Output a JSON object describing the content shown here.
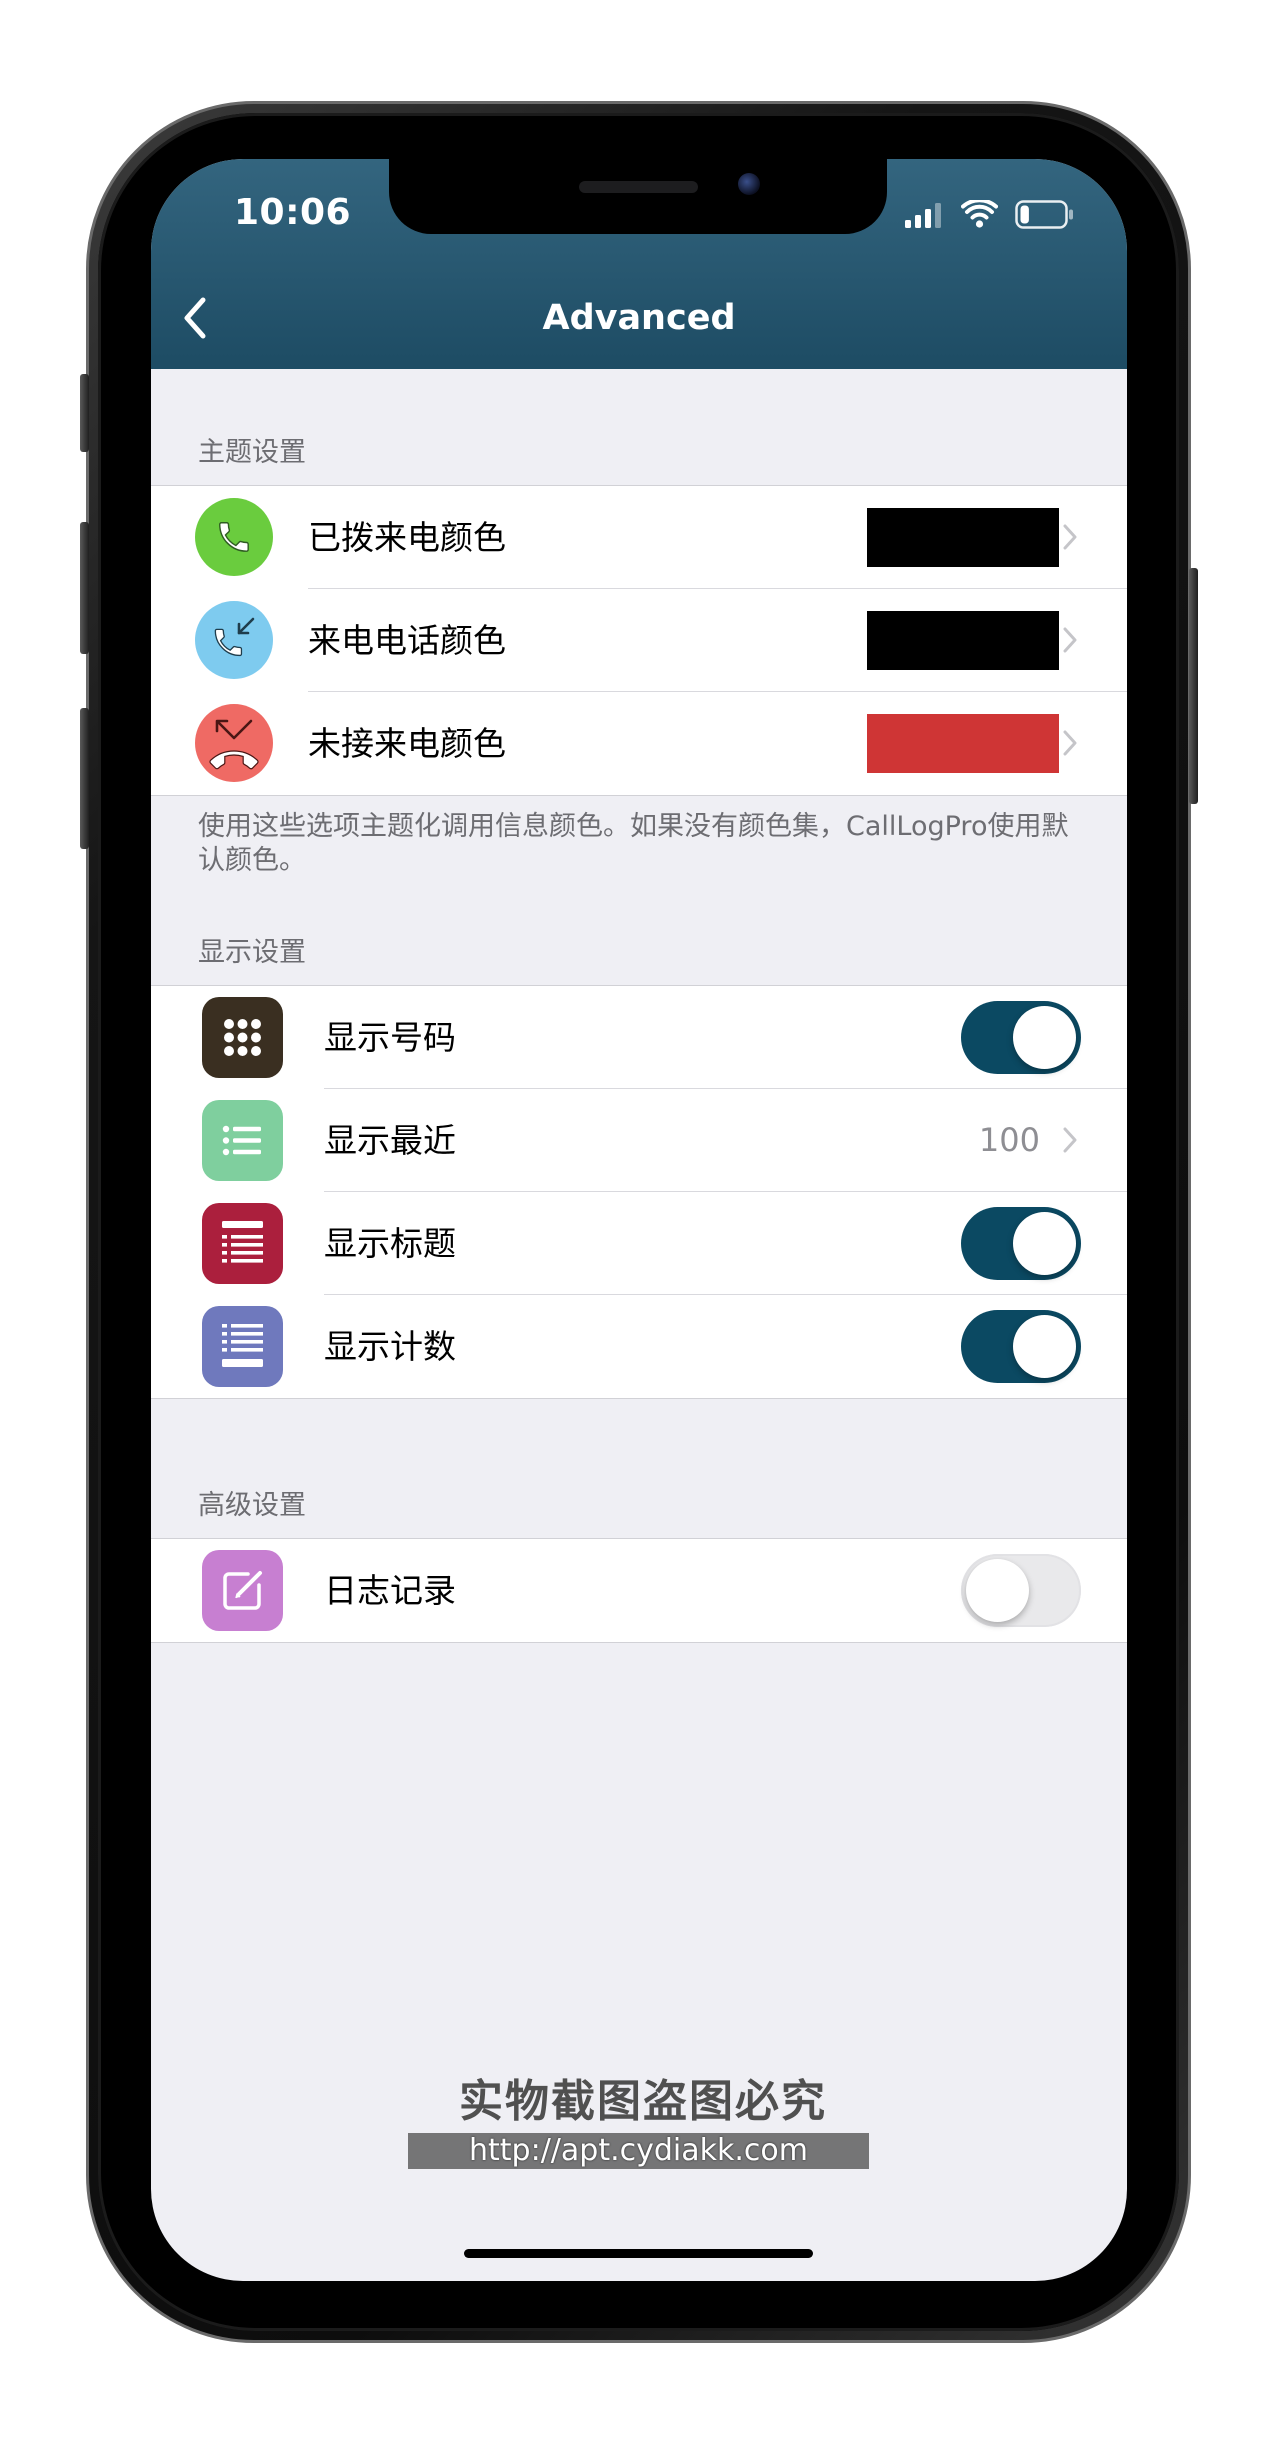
{
  "status_bar": {
    "time": "10:06",
    "signal_bars": 3,
    "battery_level": 0.2
  },
  "nav": {
    "title": "Advanced",
    "back_icon": "chevron-left-icon"
  },
  "colors": {
    "nav_bar": "#225874",
    "background": "#efeff4",
    "toggle_on": "#0b4962",
    "toggle_off": "#e9e9eb"
  },
  "theme_section": {
    "header": "主题设置",
    "rows": [
      {
        "label": "已拨来电颜色",
        "icon": "outgoing-call-icon",
        "icon_color": "#6acc3e",
        "swatch_color": "#000000"
      },
      {
        "label": "来电电话颜色",
        "icon": "incoming-call-icon",
        "icon_color": "#7ecbef",
        "swatch_color": "#000000"
      },
      {
        "label": "未接来电颜色",
        "icon": "missed-call-icon",
        "icon_color": "#ef6a64",
        "swatch_color": "#cf3535"
      }
    ],
    "footer": "使用这些选项主题化调用信息颜色。如果没有颜色集，CallLogPro使用默认颜色。"
  },
  "display_section": {
    "header": "显示设置",
    "rows": [
      {
        "label": "显示号码",
        "icon": "keypad-icon",
        "icon_color": "#3a2f21",
        "toggle": true
      },
      {
        "label": "显示最近",
        "icon": "list-icon",
        "icon_color": "#7fcf9e",
        "value": "100"
      },
      {
        "label": "显示标题",
        "icon": "list-icon",
        "icon_color": "#ab1f3d",
        "toggle": true
      },
      {
        "label": "显示计数",
        "icon": "list-icon",
        "icon_color": "#6f79bd",
        "toggle": true
      }
    ]
  },
  "advanced_section": {
    "header": "高级设置",
    "rows": [
      {
        "label": "日志记录",
        "icon": "edit-icon",
        "icon_color": "#c77fd1",
        "toggle": false
      }
    ]
  },
  "watermark": {
    "text": "实物截图盗图必究",
    "url": "http://apt.cydiakk.com"
  }
}
